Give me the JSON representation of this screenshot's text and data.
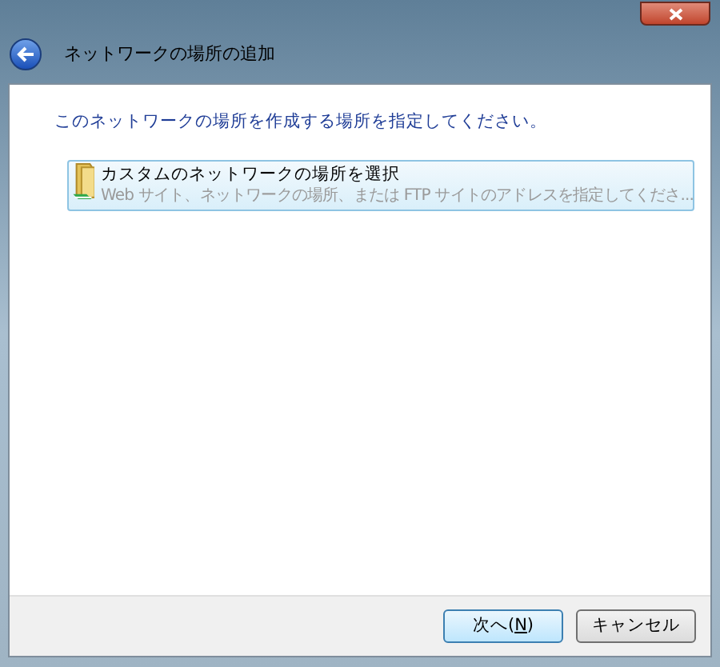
{
  "window": {
    "title": "ネットワークの場所の追加"
  },
  "instruction": "このネットワークの場所を作成する場所を指定してください。",
  "options": [
    {
      "title": "カスタムのネットワークの場所を選択",
      "description": "Web サイト、ネットワークの場所、または FTP サイトのアドレスを指定してくださ...",
      "selected": true
    }
  ],
  "buttons": [
    {
      "kind": "default",
      "label_parts": [
        "次へ(",
        "N",
        ")"
      ]
    },
    {
      "kind": "normal",
      "label_parts": [
        "キャンセル"
      ]
    }
  ]
}
